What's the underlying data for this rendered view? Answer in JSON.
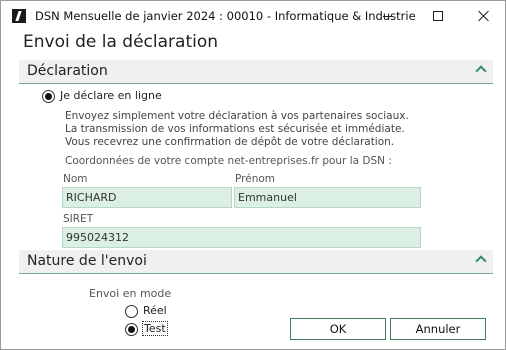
{
  "window": {
    "title": "DSN Mensuelle de janvier 2024 : 00010 - Informatique & Industrie",
    "icon": "app-logo-icon"
  },
  "page": {
    "title": "Envoi de la déclaration"
  },
  "declaration": {
    "section_title": "Déclaration",
    "option_label": "Je déclare en ligne",
    "option_selected": true,
    "info": "Envoyez simplement votre déclaration à vos partenaires sociaux. La transmission de vos informations est sécurisée et immédiate. Vous recevrez une confirmation de dépôt de votre déclaration.",
    "coords_label": "Coordonnées de votre compte net-entreprises.fr pour la DSN :",
    "nom_label": "Nom",
    "nom_value": "RICHARD",
    "prenom_label": "Prénom",
    "prenom_value": "Emmanuel",
    "siret_label": "SIRET",
    "siret_value": "995024312"
  },
  "nature": {
    "section_title": "Nature de l'envoi",
    "mode_label": "Envoi en mode",
    "options": [
      {
        "label": "Réel",
        "selected": false
      },
      {
        "label": "Test",
        "selected": true
      }
    ]
  },
  "buttons": {
    "ok": "OK",
    "cancel": "Annuler"
  },
  "colors": {
    "accent": "#2e8f5e",
    "field_bg": "#dcefe3",
    "header_bg": "#f0f0f0"
  }
}
